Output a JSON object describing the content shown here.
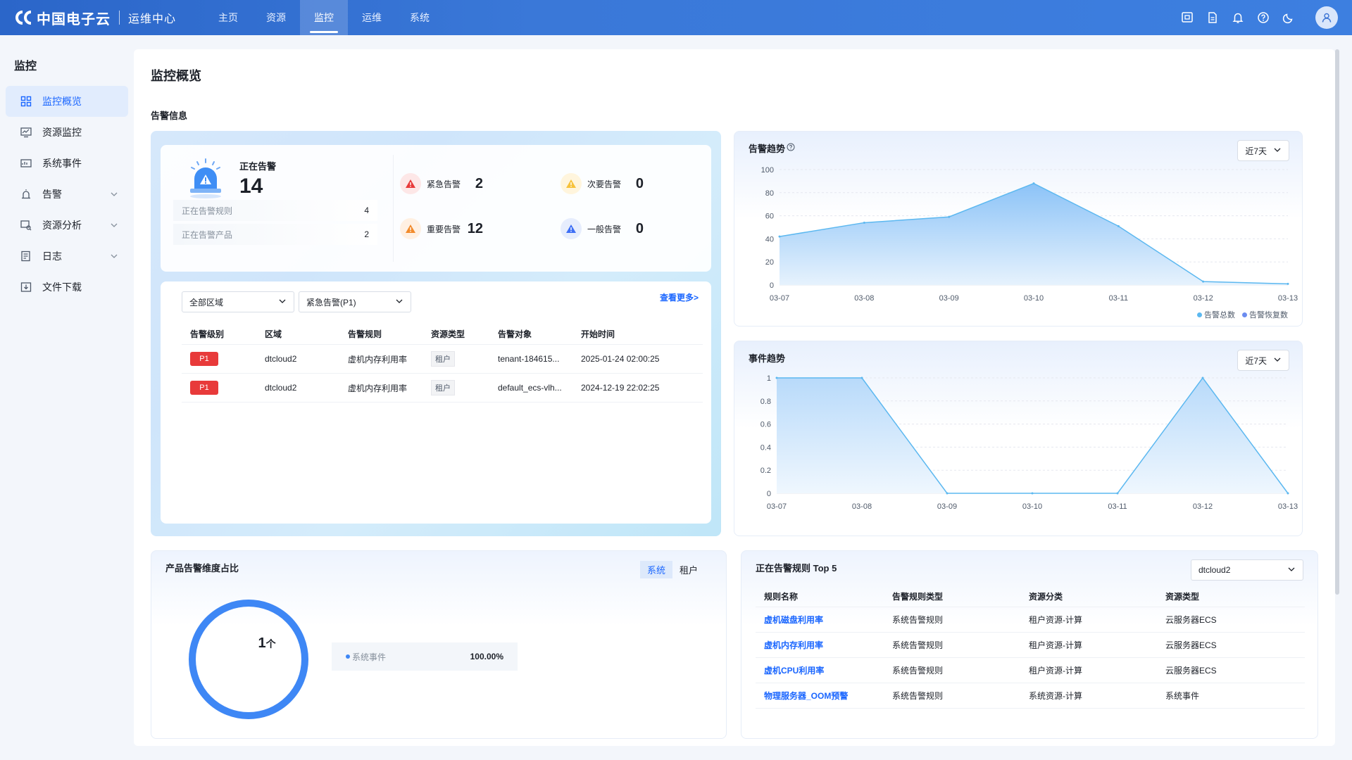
{
  "topbar": {
    "brand": "中国电子云",
    "subtitle": "运维中心",
    "nav": [
      {
        "label": "主页",
        "active": false
      },
      {
        "label": "资源",
        "active": false
      },
      {
        "label": "监控",
        "active": true
      },
      {
        "label": "运维",
        "active": false
      },
      {
        "label": "系统",
        "active": false
      }
    ],
    "icons": [
      "screen-icon",
      "document-icon",
      "bell-icon",
      "help-icon",
      "moon-icon",
      "user-avatar-icon"
    ]
  },
  "sidebar": {
    "title": "监控",
    "items": [
      {
        "label": "监控概览",
        "icon": "grid-icon",
        "active": true,
        "expandable": false
      },
      {
        "label": "资源监控",
        "icon": "monitor-icon",
        "active": false,
        "expandable": false
      },
      {
        "label": "系统事件",
        "icon": "event-icon",
        "active": false,
        "expandable": false
      },
      {
        "label": "告警",
        "icon": "alarm-icon",
        "active": false,
        "expandable": true
      },
      {
        "label": "资源分析",
        "icon": "analysis-icon",
        "active": false,
        "expandable": true
      },
      {
        "label": "日志",
        "icon": "log-icon",
        "active": false,
        "expandable": true
      },
      {
        "label": "文件下载",
        "icon": "download-icon",
        "active": false,
        "expandable": false
      }
    ]
  },
  "page": {
    "title": "监控概览",
    "section_title": "告警信息"
  },
  "alerts": {
    "firing_label": "正在告警",
    "firing_count": "14",
    "rules_label": "正在告警规则",
    "rules_count": "4",
    "products_label": "正在告警产品",
    "products_count": "2",
    "severities": [
      {
        "label": "紧急告警",
        "count": "2",
        "color": "#e83a3a"
      },
      {
        "label": "次要告警",
        "count": "0",
        "color": "#f7c23b"
      },
      {
        "label": "重要告警",
        "count": "12",
        "color": "#f28b2c"
      },
      {
        "label": "一般告警",
        "count": "0",
        "color": "#3e6ff5"
      }
    ],
    "region_select": "全部区域",
    "level_select": "紧急告警(P1)",
    "more_link": "查看更多>",
    "table": {
      "headers": [
        "告警级别",
        "区域",
        "告警规则",
        "资源类型",
        "告警对象",
        "开始时间"
      ],
      "rows": [
        {
          "level": "P1",
          "region": "dtcloud2",
          "rule": "虚机内存利用率",
          "type": "租户",
          "target": "tenant-184615...",
          "time": "2025-01-24 02:00:25"
        },
        {
          "level": "P1",
          "region": "dtcloud2",
          "rule": "虚机内存利用率",
          "type": "租户",
          "target": "default_ecs-vlh...",
          "time": "2024-12-19 22:02:25"
        }
      ]
    }
  },
  "alert_trend": {
    "title": "告警趋势",
    "range": "近7天",
    "legend": [
      {
        "label": "告警总数",
        "color": "#5cb8f0"
      },
      {
        "label": "告警恢复数",
        "color": "#6b8cf0"
      }
    ]
  },
  "event_trend": {
    "title": "事件趋势",
    "range": "近7天"
  },
  "chart_data": [
    {
      "type": "area",
      "title": "告警趋势",
      "x": [
        "03-07",
        "03-08",
        "03-09",
        "03-10",
        "03-11",
        "03-12",
        "03-13"
      ],
      "yticks": [
        "100",
        "80",
        "60",
        "40",
        "20",
        "0"
      ],
      "ylim": [
        0,
        100
      ],
      "series": [
        {
          "name": "告警总数",
          "values": [
            42,
            54,
            59,
            88,
            51,
            3,
            1
          ]
        },
        {
          "name": "告警恢复数",
          "values": [
            0,
            0,
            0,
            0,
            0,
            0,
            0
          ]
        }
      ],
      "grid": true,
      "legend": "bottom-right"
    },
    {
      "type": "area",
      "title": "事件趋势",
      "x": [
        "03-07",
        "03-08",
        "03-09",
        "03-10",
        "03-11",
        "03-12",
        "03-13"
      ],
      "yticks": [
        "1",
        "0.8",
        "0.6",
        "0.4",
        "0.2",
        "0"
      ],
      "ylim": [
        0,
        1
      ],
      "series": [
        {
          "values": [
            1,
            1,
            0,
            0,
            0,
            1,
            0
          ]
        }
      ],
      "grid": true
    }
  ],
  "product_ratio": {
    "title": "产品告警维度占比",
    "tabs": [
      {
        "label": "系统",
        "active": true
      },
      {
        "label": "租户",
        "active": false
      }
    ],
    "total": "1",
    "unit": "个",
    "items": [
      {
        "label": "系统事件",
        "percent": "100.00%",
        "fraction": 1.0,
        "color": "#3e87f5"
      }
    ]
  },
  "top5": {
    "title": "正在告警规则 Top 5",
    "region_select": "dtcloud2",
    "headers": [
      "规则名称",
      "告警规则类型",
      "资源分类",
      "资源类型"
    ],
    "rows": [
      {
        "name": "虚机磁盘利用率",
        "rule_type": "系统告警规则",
        "category": "租户资源-计算",
        "resource": "云服务器ECS"
      },
      {
        "name": "虚机内存利用率",
        "rule_type": "系统告警规则",
        "category": "租户资源-计算",
        "resource": "云服务器ECS"
      },
      {
        "name": "虚机CPU利用率",
        "rule_type": "系统告警规则",
        "category": "租户资源-计算",
        "resource": "云服务器ECS"
      },
      {
        "name": "物理服务器_OOM预警",
        "rule_type": "系统告警规则",
        "category": "系统资源-计算",
        "resource": "系统事件"
      }
    ]
  }
}
